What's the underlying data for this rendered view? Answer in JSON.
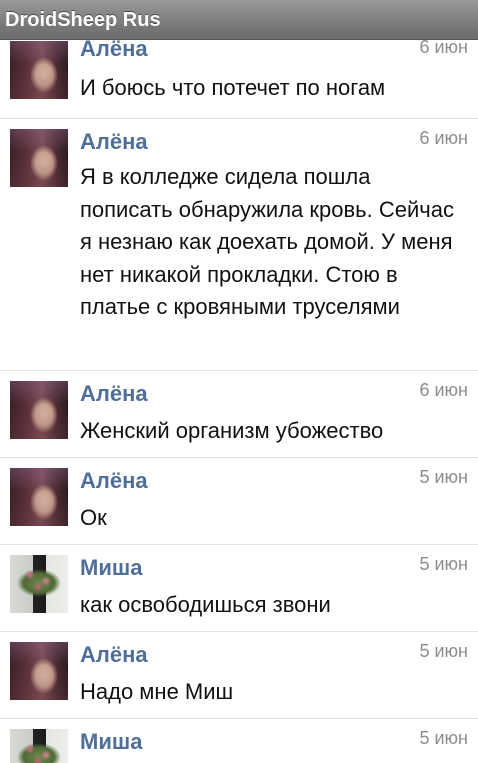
{
  "app": {
    "title": "DroidSheep Rus"
  },
  "messages": [
    {
      "sender": "Алёна",
      "date": "6 июн",
      "text": "И боюсь что потечет по ногам",
      "avatar": "alena-avatar"
    },
    {
      "sender": "Алёна",
      "date": "6 июн",
      "text": "Я в колледже сидела пошла пописать обнаружила кровь. Сейчас я незнаю как доехать домой. У меня нет никакой прокладки. Стою в платье с кровяными труселями",
      "avatar": "alena-avatar"
    },
    {
      "sender": "Алёна",
      "date": "6 июн",
      "text": "Женский организм убожество",
      "avatar": "alena-avatar"
    },
    {
      "sender": "Алёна",
      "date": "5 июн",
      "text": "Ок",
      "avatar": "alena-avatar"
    },
    {
      "sender": "Миша",
      "date": "5 июн",
      "text": "как освободишься звони",
      "avatar": "misha-avatar"
    },
    {
      "sender": "Алёна",
      "date": "5 июн",
      "text": "Надо мне Миш",
      "avatar": "alena-avatar"
    },
    {
      "sender": "Миша",
      "date": "5 июн",
      "text": "",
      "avatar": "misha-avatar"
    }
  ],
  "colors": {
    "sender": "#4f6f98",
    "date": "#8c8c8c",
    "text": "#111111",
    "titlebar": "#7d7d7d",
    "divider": "#e3e3e3"
  }
}
